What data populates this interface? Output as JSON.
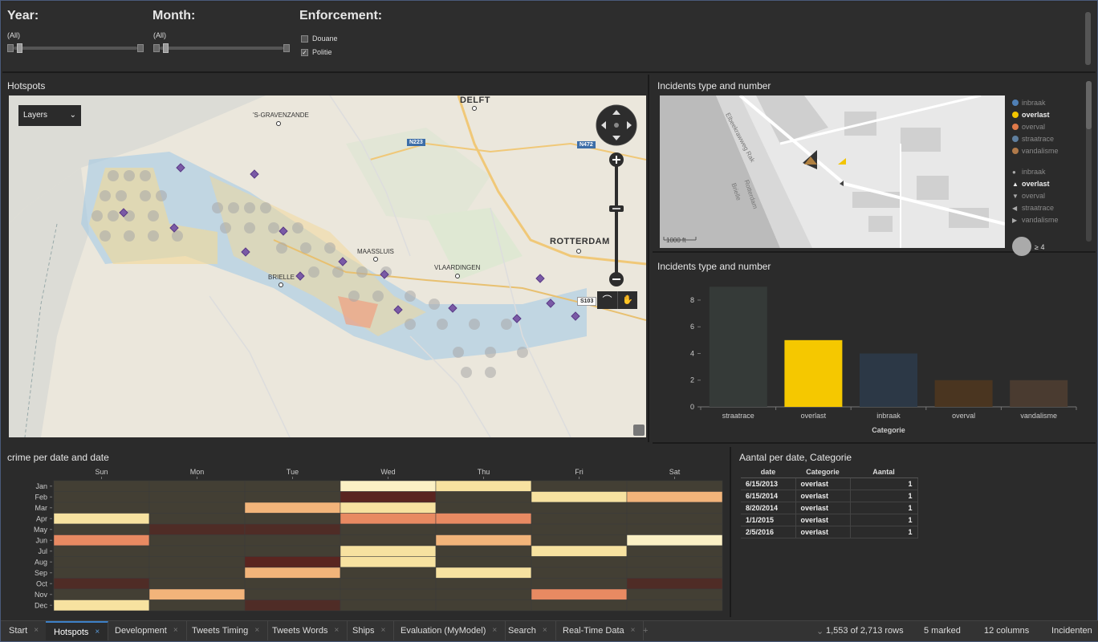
{
  "filters": {
    "year": {
      "title": "Year:",
      "value": "(All)"
    },
    "month": {
      "title": "Month:",
      "value": "(All)"
    },
    "enforcement": {
      "title": "Enforcement:",
      "options": [
        {
          "label": "Douane",
          "checked": false
        },
        {
          "label": "Politie",
          "checked": true
        }
      ]
    }
  },
  "hotspots": {
    "title": "Hotspots",
    "layers_label": "Layers",
    "places": [
      "DELFT",
      "'S-GRAVENZANDE",
      "ROTTERDAM",
      "MAASSLUIS",
      "VLAARDINGEN",
      "BRIELLE"
    ],
    "roads": [
      "N223",
      "N472",
      "S103"
    ]
  },
  "incidents_map": {
    "title": "Incidents type and number",
    "streets": [
      "Elbeekrawweg Rak",
      "Rotterdam",
      "Brielle"
    ],
    "scale": "1000 ft",
    "legend_colors": [
      {
        "label": "inbraak",
        "color": "#4f7fb5",
        "active": false
      },
      {
        "label": "overlast",
        "color": "#f2c400",
        "active": true
      },
      {
        "label": "overval",
        "color": "#e07a4a",
        "active": false
      },
      {
        "label": "straatrace",
        "color": "#5f7f9f",
        "active": false
      },
      {
        "label": "vandalisme",
        "color": "#b07a4a",
        "active": false
      }
    ],
    "legend_shapes": [
      {
        "label": "inbraak",
        "shape": "circle",
        "active": false
      },
      {
        "label": "overlast",
        "shape": "triangle-up",
        "active": true
      },
      {
        "label": "overval",
        "shape": "triangle-down",
        "active": false
      },
      {
        "label": "straatrace",
        "shape": "triangle-left",
        "active": false
      },
      {
        "label": "vandalisme",
        "shape": "triangle-right",
        "active": false
      }
    ],
    "size_label": "≥ 4"
  },
  "chart_data": [
    {
      "type": "bar",
      "title": "Incidents type and number",
      "categories": [
        "straatrace",
        "overlast",
        "inbraak",
        "overval",
        "vandalisme"
      ],
      "values": [
        9,
        5,
        4,
        2,
        2
      ],
      "colors": [
        "#353a38",
        "#f5c800",
        "#2c3846",
        "#4a3520",
        "#4a3b30"
      ],
      "xlabel": "Categorie",
      "ylabel": "",
      "ylim": [
        0,
        9.5
      ],
      "yticks": [
        0,
        2,
        4,
        6,
        8
      ]
    },
    {
      "type": "heatmap",
      "title": "crime per date and date",
      "x": [
        "Sun",
        "Mon",
        "Tue",
        "Wed",
        "Thu",
        "Fri",
        "Sat"
      ],
      "y": [
        "Jan",
        "Feb",
        "Mar",
        "Apr",
        "May",
        "Jun",
        "Jul",
        "Aug",
        "Sep",
        "Oct",
        "Nov",
        "Dec"
      ],
      "values": [
        [
          0,
          0,
          0,
          3,
          2,
          0,
          0
        ],
        [
          0,
          0,
          0,
          5,
          0,
          2,
          1
        ],
        [
          0,
          0,
          1,
          2,
          0,
          0,
          0
        ],
        [
          2,
          0,
          0,
          4,
          4,
          0,
          0
        ],
        [
          0,
          6,
          6,
          0,
          0,
          0,
          0
        ],
        [
          4,
          0,
          0,
          0,
          1,
          0,
          3
        ],
        [
          0,
          0,
          0,
          2,
          0,
          2,
          0
        ],
        [
          0,
          0,
          5,
          2,
          0,
          0,
          0
        ],
        [
          0,
          0,
          1,
          0,
          2,
          0,
          0
        ],
        [
          6,
          0,
          0,
          0,
          0,
          0,
          6
        ],
        [
          0,
          1,
          0,
          0,
          0,
          4,
          0
        ],
        [
          2,
          0,
          6,
          0,
          0,
          0,
          0
        ]
      ]
    }
  ],
  "aantal": {
    "title": "Aantal per date, Categorie",
    "columns": [
      "date",
      "Categorie",
      "Aantal"
    ],
    "rows": [
      [
        "6/15/2013",
        "overlast",
        "1"
      ],
      [
        "6/15/2014",
        "overlast",
        "1"
      ],
      [
        "8/20/2014",
        "overlast",
        "1"
      ],
      [
        "1/1/2015",
        "overlast",
        "1"
      ],
      [
        "2/5/2016",
        "overlast",
        "1"
      ]
    ]
  },
  "tabs": [
    {
      "label": "Start",
      "active": false
    },
    {
      "label": "Hotspots",
      "active": true
    },
    {
      "label": "Development",
      "active": false
    },
    {
      "label": "Tweets Timing",
      "active": false
    },
    {
      "label": "Tweets Words",
      "active": false
    },
    {
      "label": "Ships",
      "active": false
    },
    {
      "label": "Evaluation (MyModel)",
      "active": false
    },
    {
      "label": "Search",
      "active": false
    },
    {
      "label": "Real-Time Data",
      "active": false
    }
  ],
  "status": {
    "rows": "1,553 of 2,713 rows",
    "marked": "5 marked",
    "columns": "12 columns",
    "table": "Incidenten"
  }
}
